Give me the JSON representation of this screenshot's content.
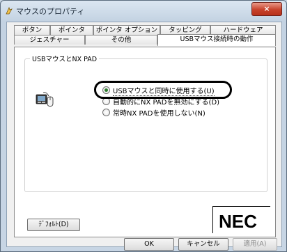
{
  "window": {
    "title": "マウスのプロパティ",
    "close_glyph": "×"
  },
  "tabs_row1": [
    "ボタン",
    "ポインタ",
    "ポインタ オプション",
    "タッピング",
    "ハードウェア"
  ],
  "tabs_row2": [
    "ジェスチャー",
    "その他",
    "USBマウス接続時の動作"
  ],
  "active_tab": "USBマウス接続時の動作",
  "group": {
    "label": "USBマウスとNX PAD"
  },
  "options": [
    {
      "label": "USBマウスと同時に使用する(U)",
      "selected": true
    },
    {
      "label": "自動的にNX PADを無効にする(D)",
      "selected": false
    },
    {
      "label": "常時NX PADを使用しない(N)",
      "selected": false
    }
  ],
  "buttons": {
    "default": "ﾃﾞﾌｫﾙﾄ(D)",
    "ok": "OK",
    "cancel": "キャンセル",
    "apply": "適用(A)"
  },
  "logo": "NEC",
  "icons": {
    "title": "mouse-icon",
    "device": "touchpad-mouse-icon"
  },
  "colors": {
    "selected_radio": "#2b7a2b",
    "close_button": "#c7422b",
    "highlight_ring": "#000000"
  }
}
